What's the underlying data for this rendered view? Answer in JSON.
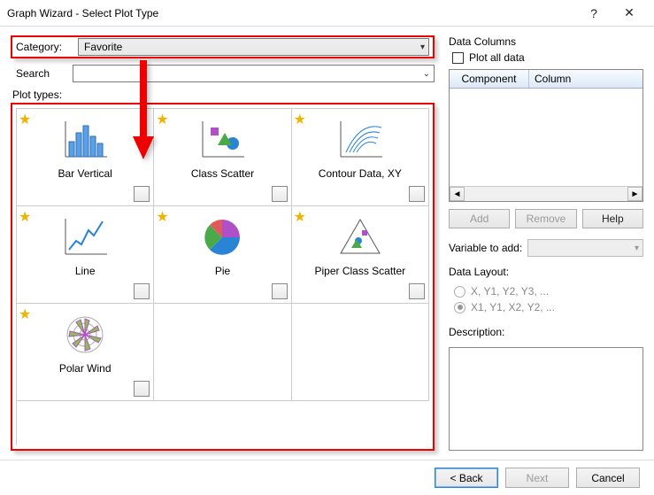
{
  "window": {
    "title": "Graph Wizard - Select Plot Type",
    "help_btn": "?",
    "close_btn": "✕"
  },
  "left": {
    "category_label": "Category:",
    "category_value": "Favorite",
    "search_label": "Search",
    "search_value": "",
    "plot_types_label": "Plot types:",
    "plots": [
      {
        "label": "Bar Vertical"
      },
      {
        "label": "Class Scatter"
      },
      {
        "label": "Contour Data, XY"
      },
      {
        "label": "Line"
      },
      {
        "label": "Pie"
      },
      {
        "label": "Piper Class Scatter"
      },
      {
        "label": "Polar Wind"
      }
    ]
  },
  "right": {
    "data_columns_label": "Data Columns",
    "plot_all_label": "Plot all data",
    "table": {
      "col1": "Component",
      "col2": "Column"
    },
    "buttons": {
      "add": "Add",
      "remove": "Remove",
      "help": "Help"
    },
    "variable_label": "Variable to add:",
    "data_layout_label": "Data Layout:",
    "radio1": "X, Y1, Y2, Y3, ...",
    "radio2": "X1, Y1, X2, Y2, ...",
    "description_label": "Description:"
  },
  "footer": {
    "back": "< Back",
    "next": "Next",
    "cancel": "Cancel"
  }
}
